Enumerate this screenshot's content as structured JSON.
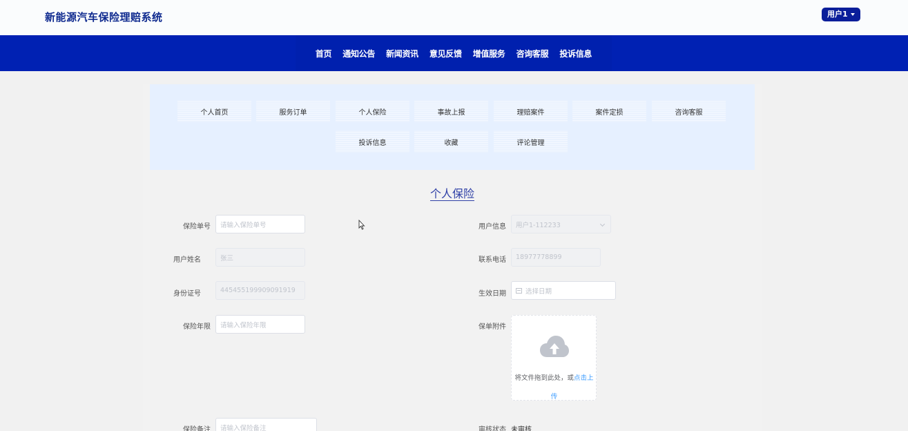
{
  "header": {
    "site_title": "新能源汽车保险理赔系统",
    "user_label": "用户1"
  },
  "nav": {
    "items": [
      "首页",
      "通知公告",
      "新闻资讯",
      "意见反馈",
      "增值服务",
      "咨询客服",
      "投诉信息"
    ]
  },
  "sub_menu": {
    "items": [
      "个人首页",
      "服务订单",
      "个人保险",
      "事故上报",
      "理赔案件",
      "案件定损",
      "咨询客服",
      "投诉信息",
      "收藏",
      "评论管理"
    ]
  },
  "page": {
    "title": "个人保险"
  },
  "form": {
    "policy_no": {
      "label": "保险单号",
      "placeholder": "请输入保险单号"
    },
    "user_info": {
      "label": "用户信息",
      "value": "用户1-112233"
    },
    "user_name": {
      "label": "用户姓名",
      "value": "张三"
    },
    "phone": {
      "label": "联系电话",
      "value": "18977778899"
    },
    "id_no": {
      "label": "身份证号",
      "value": "445455199909091919"
    },
    "effective_date": {
      "label": "生效日期",
      "placeholder": "选择日期"
    },
    "term": {
      "label": "保险年限",
      "placeholder": "请输入保险年限"
    },
    "attachment": {
      "label": "保单附件",
      "upload_text": "将文件拖到此处，或",
      "upload_link_1": "点击上",
      "upload_link_2": "传"
    },
    "remark": {
      "label": "保险备注",
      "placeholder": "请输入保险备注"
    },
    "review_status": {
      "label": "审核状态",
      "value": "未审核"
    }
  },
  "colors": {
    "nav_bg": "#0021b3",
    "brand_text": "#0f2a8f",
    "link": "#409eff",
    "submenu_bg": "#e6f0ff"
  }
}
